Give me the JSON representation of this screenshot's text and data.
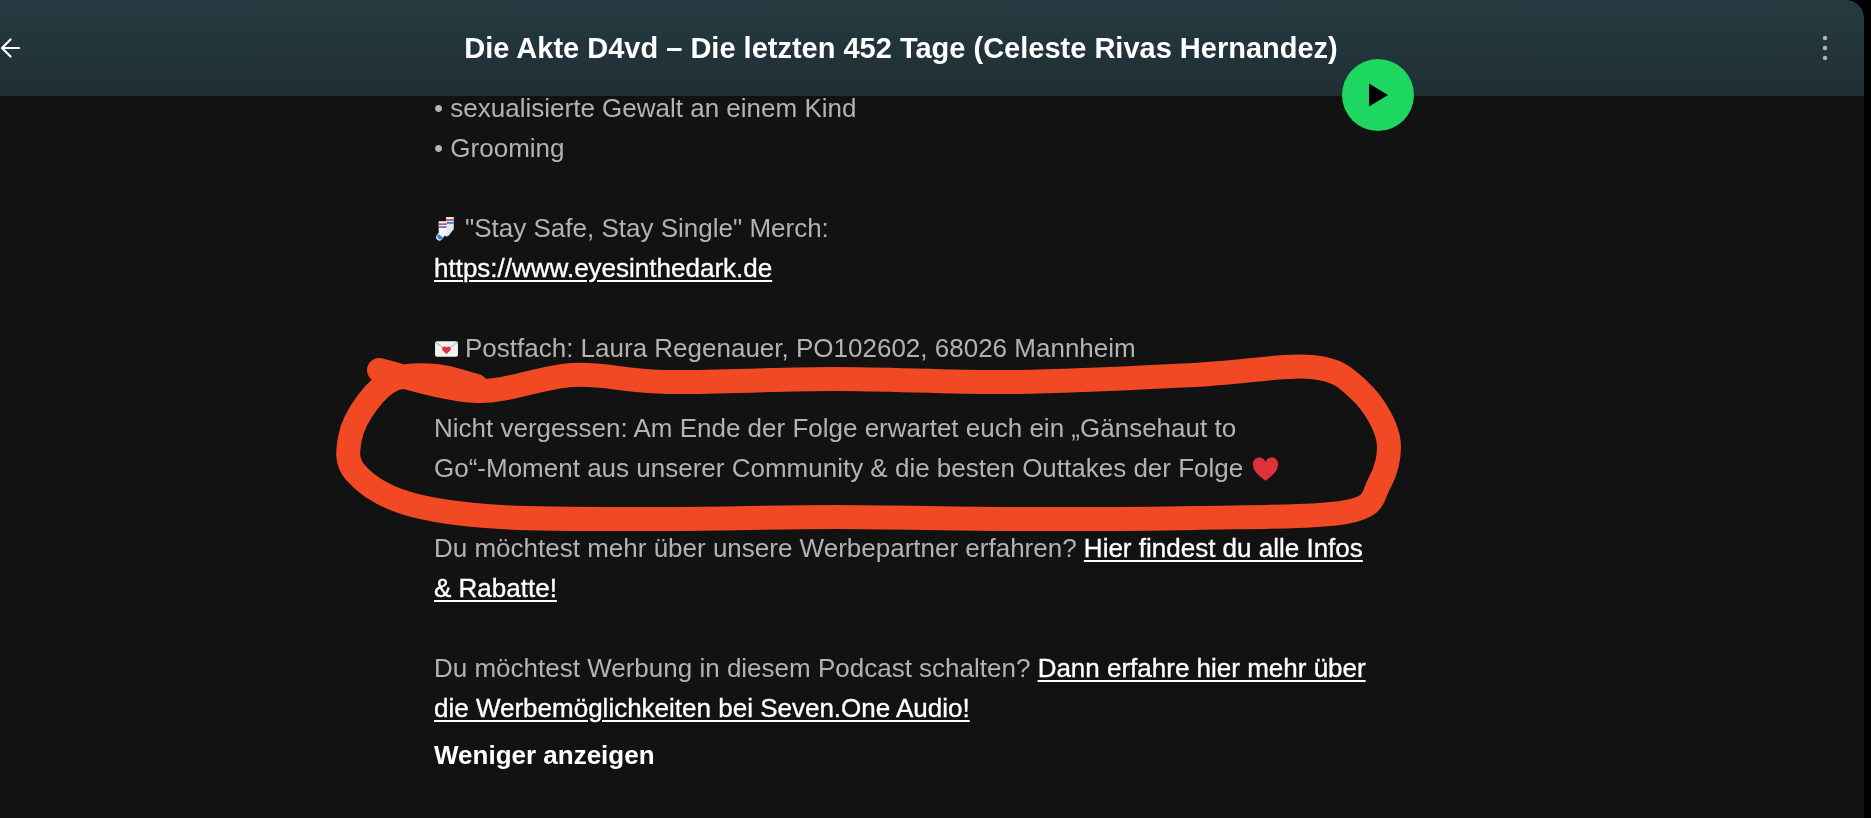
{
  "header": {
    "title": "Die Akte D4vd – Die letzten 452 Tage (Celeste Rivas Hernandez)"
  },
  "description": [
    {
      "kind": "lines",
      "highlighted": false,
      "lines": [
        "• sexualisierte Gewalt an einem Kind",
        "• Grooming"
      ]
    },
    {
      "kind": "merch",
      "highlighted": false,
      "text": "\"Stay Safe, Stay Single\" Merch:",
      "url": "https://www.eyesinthedark.de"
    },
    {
      "kind": "mail",
      "highlighted": false,
      "text": "Postfach: Laura Regenauer, PO102602, 68026 Mannheim"
    },
    {
      "kind": "note",
      "highlighted": true,
      "text": "Nicht vergessen: Am Ende der Folge erwartet euch ein „Gänsehaut to Go“-Moment aus unserer Community & die besten Outtakes der Folge"
    },
    {
      "kind": "promo",
      "highlighted": false,
      "text": "Du möchtest mehr über unsere Werbepartner erfahren?",
      "link_lines": [
        "Hier findest du alle Infos",
        "& Rabatte!"
      ]
    },
    {
      "kind": "promo",
      "highlighted": false,
      "text": "Du möchtest Werbung in diesem Podcast schalten?",
      "link_lines": [
        "Dann erfahre hier mehr über",
        "die Werbemöglichkeiten bei Seven.One Audio!"
      ]
    }
  ],
  "show_less": {
    "label": "Weniger anzeigen"
  }
}
